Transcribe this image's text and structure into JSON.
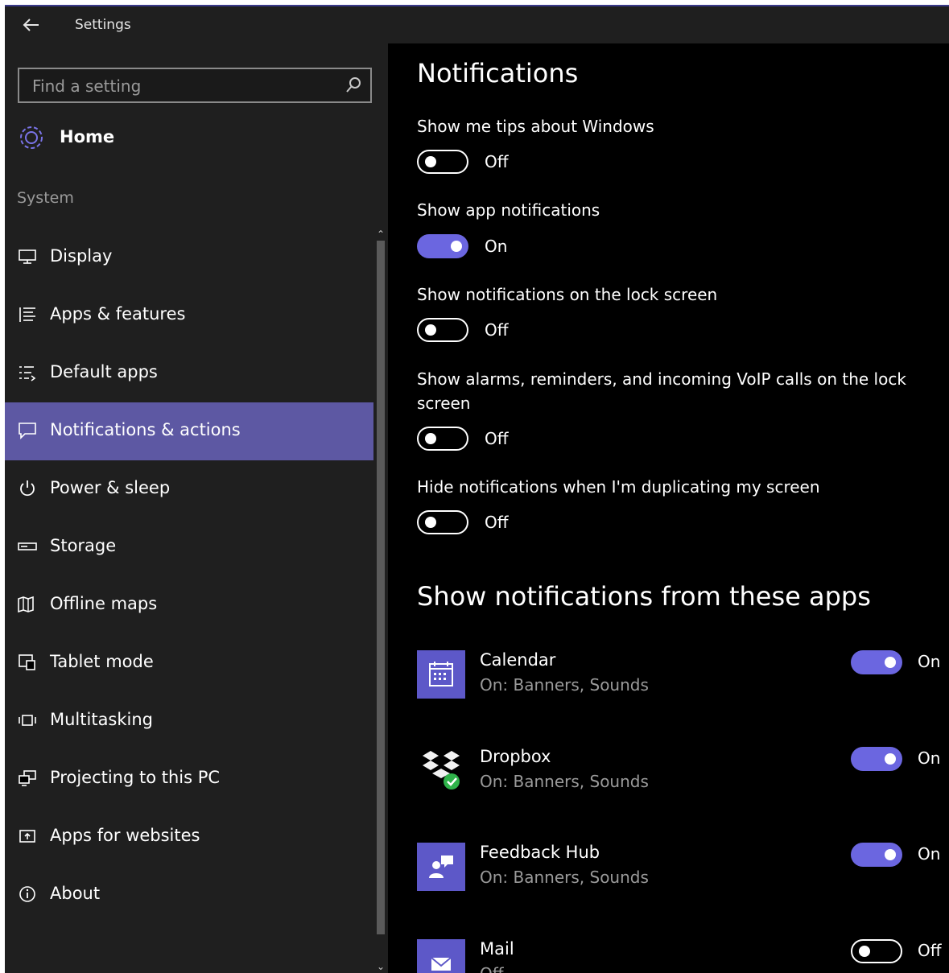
{
  "window": {
    "title": "Settings"
  },
  "search": {
    "placeholder": "Find a setting"
  },
  "home": {
    "label": "Home"
  },
  "section": {
    "label": "System"
  },
  "sidebar": {
    "items": [
      {
        "label": "Display",
        "icon": "display-icon"
      },
      {
        "label": "Apps & features",
        "icon": "apps-features-icon"
      },
      {
        "label": "Default apps",
        "icon": "default-apps-icon"
      },
      {
        "label": "Notifications & actions",
        "icon": "notifications-icon",
        "active": true
      },
      {
        "label": "Power & sleep",
        "icon": "power-icon"
      },
      {
        "label": "Storage",
        "icon": "storage-icon"
      },
      {
        "label": "Offline maps",
        "icon": "map-icon"
      },
      {
        "label": "Tablet mode",
        "icon": "tablet-icon"
      },
      {
        "label": "Multitasking",
        "icon": "multitasking-icon"
      },
      {
        "label": "Projecting to this PC",
        "icon": "projecting-icon"
      },
      {
        "label": "Apps for websites",
        "icon": "apps-websites-icon"
      },
      {
        "label": "About",
        "icon": "info-icon"
      }
    ]
  },
  "main": {
    "title": "Notifications",
    "settings": [
      {
        "label": "Show me tips about Windows",
        "state": "Off",
        "on": false
      },
      {
        "label": "Show app notifications",
        "state": "On",
        "on": true
      },
      {
        "label": "Show notifications on the lock screen",
        "state": "Off",
        "on": false
      },
      {
        "label": "Show alarms, reminders, and incoming VoIP calls on the lock screen",
        "state": "Off",
        "on": false
      },
      {
        "label": "Hide notifications when I'm duplicating my screen",
        "state": "Off",
        "on": false
      }
    ],
    "apps_heading": "Show notifications from these apps",
    "apps": [
      {
        "name": "Calendar",
        "sub": "On: Banners, Sounds",
        "state": "On",
        "on": true,
        "icon": "calendar-icon"
      },
      {
        "name": "Dropbox",
        "sub": "On: Banners, Sounds",
        "state": "On",
        "on": true,
        "icon": "dropbox-icon"
      },
      {
        "name": "Feedback Hub",
        "sub": "On: Banners, Sounds",
        "state": "On",
        "on": true,
        "icon": "feedback-hub-icon"
      },
      {
        "name": "Mail",
        "sub": "Off",
        "state": "Off",
        "on": false,
        "icon": "mail-icon"
      }
    ]
  },
  "colors": {
    "accent": "#6b66e0",
    "active_nav": "#5d58a3",
    "pane_left": "#1f1f1f",
    "pane_right": "#000000"
  }
}
